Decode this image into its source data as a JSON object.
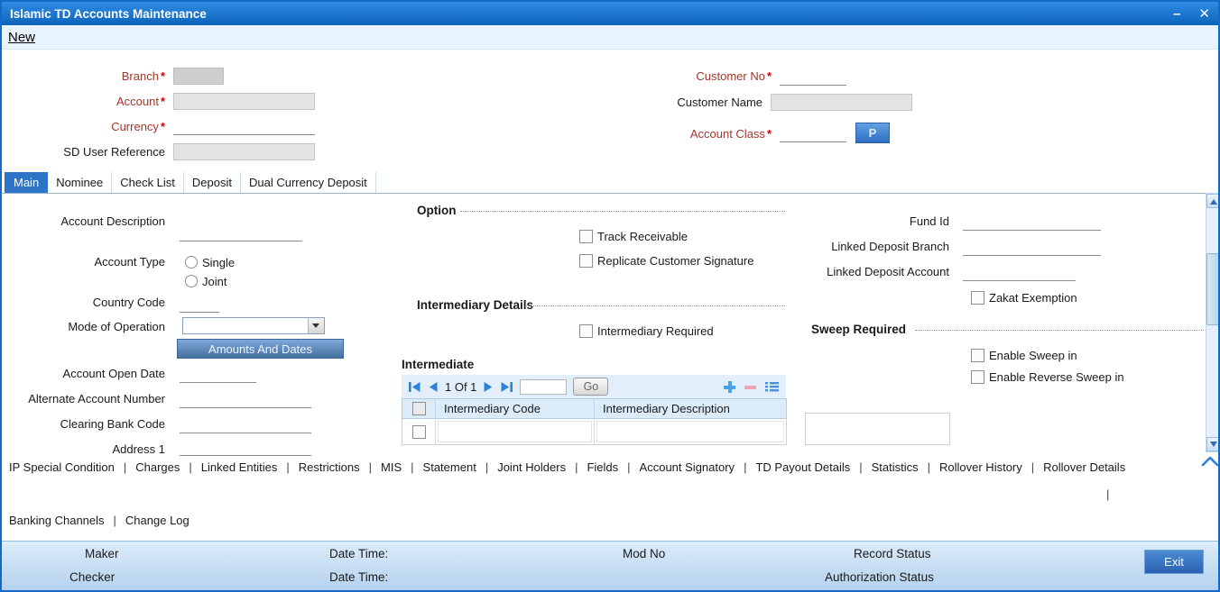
{
  "window": {
    "title": "Islamic TD Accounts Maintenance"
  },
  "titlebar": {
    "minimize_icon": "–",
    "close_icon": "✕"
  },
  "menubar": {
    "new_label": "New"
  },
  "misc": {
    "required_marker": "*"
  },
  "header": {
    "branch_label": "Branch",
    "customer_no_label": "Customer No",
    "account_label": "Account",
    "customer_name_label": "Customer Name",
    "currency_label": "Currency",
    "account_class_label": "Account Class",
    "account_class_p_button": "P",
    "sd_user_reference_label": "SD User Reference"
  },
  "tabs": [
    "Main",
    "Nominee",
    "Check List",
    "Deposit",
    "Dual Currency Deposit"
  ],
  "main_tab": {
    "account_description_label": "Account Description",
    "account_type_label": "Account Type",
    "single_label": "Single",
    "joint_label": "Joint",
    "country_code_label": "Country Code",
    "mode_of_operation_label": "Mode of Operation",
    "amounts_and_dates_button": "Amounts And Dates",
    "account_open_date_label": "Account Open Date",
    "alternate_account_number_label": "Alternate Account Number",
    "clearing_bank_code_label": "Clearing Bank Code",
    "address_1_label": "Address 1",
    "option_title": "Option",
    "track_receivable_label": "Track Receivable",
    "replicate_customer_signature_label": "Replicate Customer Signature",
    "intermediary_details_title": "Intermediary Details",
    "intermediary_required_label": "Intermediary Required",
    "intermediate_title": "Intermediate",
    "page_status": "1 Of 1",
    "go_button": "Go",
    "grid_columns": [
      "Intermediary Code",
      "Intermediary Description"
    ],
    "fund_id_label": "Fund Id",
    "linked_deposit_branch_label": "Linked Deposit Branch",
    "linked_deposit_account_label": "Linked Deposit Account",
    "zakat_exemption_label": "Zakat Exemption",
    "sweep_required_title": "Sweep Required",
    "enable_sweep_in_label": "Enable Sweep in",
    "enable_reverse_sweep_in_label": "Enable Reverse Sweep in"
  },
  "bottom_links_row1": [
    "IP Special Condition",
    "Charges",
    "Linked Entities",
    "Restrictions",
    "MIS",
    "Statement",
    "Joint Holders",
    "Fields",
    "Account Signatory",
    "TD Payout Details",
    "Statistics",
    "Rollover History",
    "Rollover Details"
  ],
  "bottom_links_row2": [
    "Banking Channels",
    "Change Log"
  ],
  "footer": {
    "maker_label": "Maker",
    "checker_label": "Checker",
    "date_time_label_1": "Date Time:",
    "date_time_label_2": "Date Time:",
    "mod_no_label": "Mod No",
    "record_status_label": "Record Status",
    "authorization_status_label": "Authorization Status",
    "exit_button": "Exit"
  },
  "colors": {
    "titlebar_blue": "#1070cd",
    "accent_blue": "#2e74c6",
    "label_red": "#a3342e",
    "required_red": "#cc0000"
  }
}
